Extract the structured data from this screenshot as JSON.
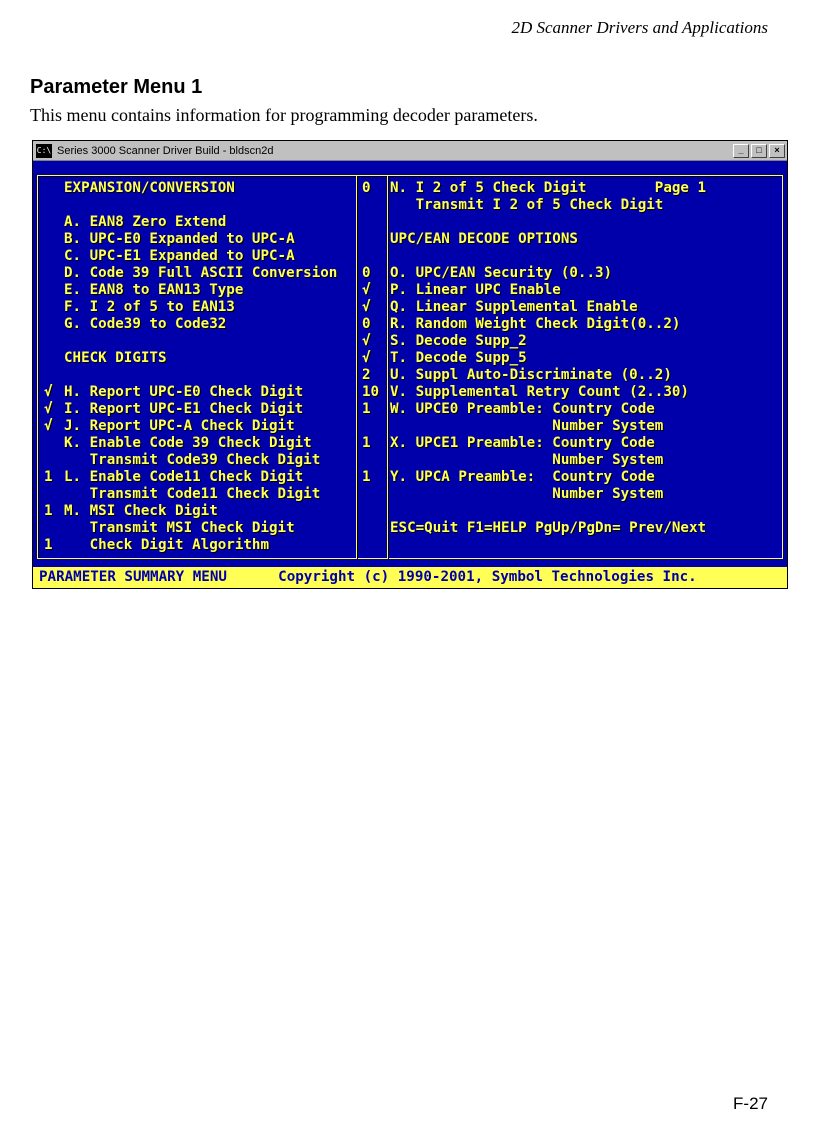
{
  "doc": {
    "header": "2D Scanner Drivers and Applications",
    "section_title": "Parameter Menu 1",
    "section_desc": "This menu contains information for programming decoder parameters.",
    "page_number": "F-27"
  },
  "window": {
    "title": "Series 3000 Scanner Driver Build - bldscn2d",
    "sysicon": "C:\\",
    "min": "_",
    "max": "□",
    "close": "×"
  },
  "terminal": {
    "left": {
      "header": "EXPANSION/CONVERSION",
      "items_a": [
        "A. EAN8 Zero Extend",
        "B. UPC-E0 Expanded to UPC-A",
        "C. UPC-E1 Expanded to UPC-A",
        "D. Code 39 Full ASCII Conversion",
        "E. EAN8 to EAN13 Type",
        "F. I 2 of 5 to EAN13",
        "G. Code39 to Code32"
      ],
      "header2": "CHECK DIGITS",
      "items_b": [
        {
          "mark": "√",
          "text": "H. Report UPC-E0 Check Digit"
        },
        {
          "mark": "√",
          "text": "I. Report UPC-E1 Check Digit"
        },
        {
          "mark": "√",
          "text": "J. Report UPC-A Check Digit"
        },
        {
          "mark": "",
          "text": "K. Enable Code 39 Check Digit"
        },
        {
          "mark": "",
          "text": "   Transmit Code39 Check Digit"
        },
        {
          "mark": "1",
          "text": "L. Enable Code11 Check Digit"
        },
        {
          "mark": "",
          "text": "   Transmit Code11 Check Digit"
        },
        {
          "mark": "1",
          "text": "M. MSI Check Digit"
        },
        {
          "mark": "",
          "text": "   Transmit MSI Check Digit"
        },
        {
          "mark": "1",
          "text": "   Check Digit Algorithm"
        }
      ]
    },
    "right": {
      "rows": [
        {
          "val": "0",
          "text": "N. I 2 of 5 Check Digit        Page 1"
        },
        {
          "val": "",
          "text": "   Transmit I 2 of 5 Check Digit"
        },
        {
          "val": "",
          "text": ""
        },
        {
          "val": "",
          "text": "UPC/EAN DECODE OPTIONS"
        },
        {
          "val": "",
          "text": ""
        },
        {
          "val": "0",
          "text": "O. UPC/EAN Security (0..3)"
        },
        {
          "val": "√",
          "text": "P. Linear UPC Enable"
        },
        {
          "val": "√",
          "text": "Q. Linear Supplemental Enable"
        },
        {
          "val": "0",
          "text": "R. Random Weight Check Digit(0..2)"
        },
        {
          "val": "√",
          "text": "S. Decode Supp_2"
        },
        {
          "val": "√",
          "text": "T. Decode Supp_5"
        },
        {
          "val": "2",
          "text": "U. Suppl Auto-Discriminate (0..2)"
        },
        {
          "val": "10",
          "text": "V. Supplemental Retry Count (2..30)"
        },
        {
          "val": "1",
          "text": "W. UPCE0 Preamble: Country Code"
        },
        {
          "val": "",
          "text": "                   Number System"
        },
        {
          "val": "1",
          "text": "X. UPCE1 Preamble: Country Code"
        },
        {
          "val": "",
          "text": "                   Number System"
        },
        {
          "val": "1",
          "text": "Y. UPCA Preamble:  Country Code"
        },
        {
          "val": "",
          "text": "                   Number System"
        },
        {
          "val": "",
          "text": ""
        },
        {
          "val": "",
          "text": "ESC=Quit F1=HELP PgUp/PgDn= Prev/Next"
        }
      ]
    },
    "footer": "PARAMETER SUMMARY MENU      Copyright (c) 1990-2001, Symbol Technologies Inc."
  }
}
